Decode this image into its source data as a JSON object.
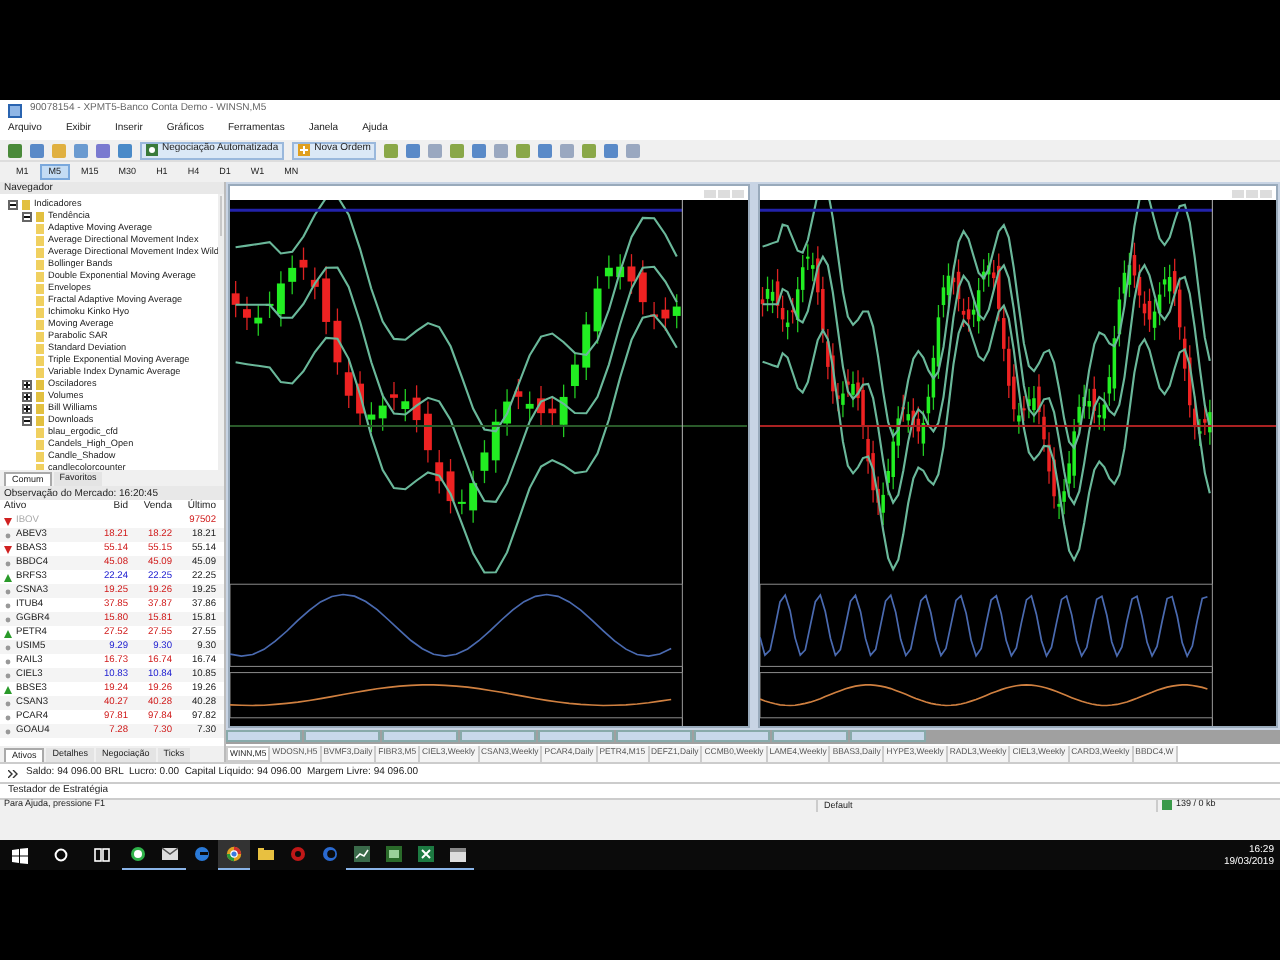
{
  "window": {
    "title": "90078154 - XPMT5-Banco Conta Demo - WINSN,M5"
  },
  "menu": [
    "Arquivo",
    "Exibir",
    "Inserir",
    "Gráficos",
    "Ferramentas",
    "Janela",
    "Ajuda"
  ],
  "toolbar": {
    "buttons": [
      {
        "kind": "auto",
        "label": "Negociação Automatizada"
      },
      {
        "kind": "order",
        "label": "Nova Ordem"
      }
    ]
  },
  "timeframes": [
    {
      "label": "M1",
      "selected": false
    },
    {
      "label": "M5",
      "selected": true
    },
    {
      "label": "M15",
      "selected": false
    },
    {
      "label": "M30",
      "selected": false
    },
    {
      "label": "H1",
      "selected": false
    },
    {
      "label": "H4",
      "selected": false
    },
    {
      "label": "D1",
      "selected": false
    },
    {
      "label": "W1",
      "selected": false
    },
    {
      "label": "MN",
      "selected": false
    }
  ],
  "navigator": {
    "title": "Navegador",
    "tree": [
      {
        "label": "Indicadores",
        "expanded": true,
        "children": [
          {
            "label": "Tendência",
            "expanded": true,
            "children": [
              {
                "label": "Adaptive Moving Average"
              },
              {
                "label": "Average Directional Movement Index"
              },
              {
                "label": "Average Directional Movement Index Wild"
              },
              {
                "label": "Bollinger Bands"
              },
              {
                "label": "Double Exponential Moving Average"
              },
              {
                "label": "Envelopes"
              },
              {
                "label": "Fractal Adaptive Moving Average"
              },
              {
                "label": "Ichimoku Kinko Hyo"
              },
              {
                "label": "Moving Average"
              },
              {
                "label": "Parabolic SAR"
              },
              {
                "label": "Standard Deviation"
              },
              {
                "label": "Triple Exponential Moving Average"
              },
              {
                "label": "Variable Index Dynamic Average"
              }
            ]
          },
          {
            "label": "Osciladores",
            "expanded": false
          },
          {
            "label": "Volumes",
            "expanded": false
          },
          {
            "label": "Bill Williams",
            "expanded": false
          },
          {
            "label": "Downloads",
            "expanded": true,
            "children": [
              {
                "label": "blau_ergodic_cfd"
              },
              {
                "label": "Candels_High_Open"
              },
              {
                "label": "Candle_Shadow"
              },
              {
                "label": "candlecolorcounter"
              }
            ]
          }
        ]
      }
    ],
    "tabs": [
      {
        "label": "Comum",
        "selected": true
      },
      {
        "label": "Favoritos",
        "selected": false
      }
    ]
  },
  "market_watch": {
    "title": "Observação do Mercado: 16:20:45",
    "columns": [
      "Ativo",
      "Bid",
      "Venda",
      "Último"
    ],
    "rows": [
      {
        "kind": "down",
        "symbol": "IBOV",
        "disabled": true,
        "last": "97502"
      },
      {
        "kind": "flat",
        "symbol": "ABEV3",
        "disabled": false,
        "rising": false,
        "bid": "18.21",
        "ask": "18.22",
        "last": "18.21"
      },
      {
        "kind": "down",
        "symbol": "BBAS3",
        "disabled": false,
        "rising": false,
        "bid": "55.14",
        "ask": "55.15",
        "last": "55.14"
      },
      {
        "kind": "flat",
        "symbol": "BBDC4",
        "disabled": false,
        "rising": false,
        "bid": "45.08",
        "ask": "45.09",
        "last": "45.09"
      },
      {
        "kind": "up",
        "symbol": "BRFS3",
        "disabled": false,
        "rising": true,
        "bid": "22.24",
        "ask": "22.25",
        "last": "22.25"
      },
      {
        "kind": "flat",
        "symbol": "CSNA3",
        "disabled": false,
        "rising": false,
        "bid": "19.25",
        "ask": "19.26",
        "last": "19.25"
      },
      {
        "kind": "flat",
        "symbol": "ITUB4",
        "disabled": false,
        "rising": false,
        "bid": "37.85",
        "ask": "37.87",
        "last": "37.86"
      },
      {
        "kind": "flat",
        "symbol": "GGBR4",
        "disabled": false,
        "rising": false,
        "bid": "15.80",
        "ask": "15.81",
        "last": "15.81"
      },
      {
        "kind": "up",
        "symbol": "PETR4",
        "disabled": false,
        "rising": false,
        "bid": "27.52",
        "ask": "27.55",
        "last": "27.55"
      },
      {
        "kind": "flat",
        "symbol": "USIM5",
        "disabled": false,
        "rising": true,
        "bid": "9.29",
        "ask": "9.30",
        "last": "9.30"
      },
      {
        "kind": "flat",
        "symbol": "RAIL3",
        "disabled": false,
        "rising": false,
        "bid": "16.73",
        "ask": "16.74",
        "last": "16.74"
      },
      {
        "kind": "flat",
        "symbol": "CIEL3",
        "disabled": false,
        "rising": true,
        "bid": "10.83",
        "ask": "10.84",
        "last": "10.85"
      },
      {
        "kind": "up",
        "symbol": "BBSE3",
        "disabled": false,
        "rising": false,
        "bid": "19.24",
        "ask": "19.26",
        "last": "19.26"
      },
      {
        "kind": "flat",
        "symbol": "CSAN3",
        "disabled": false,
        "rising": false,
        "bid": "40.27",
        "ask": "40.28",
        "last": "40.28"
      },
      {
        "kind": "flat",
        "symbol": "PCAR4",
        "disabled": false,
        "rising": false,
        "bid": "97.81",
        "ask": "97.84",
        "last": "97.82"
      },
      {
        "kind": "flat",
        "symbol": "GOAU4",
        "disabled": false,
        "rising": false,
        "bid": "7.28",
        "ask": "7.30",
        "last": "7.30"
      }
    ],
    "tabs": [
      {
        "label": "Ativos",
        "selected": true
      },
      {
        "label": "Detalhes",
        "selected": false
      },
      {
        "label": "Negociação",
        "selected": false
      },
      {
        "label": "Ticks",
        "selected": false
      }
    ]
  },
  "chart_tabs": [
    {
      "label": "WINN,M5",
      "selected": true
    },
    {
      "label": "WDOSN,H5",
      "selected": false
    },
    {
      "label": "BVMF3,Daily",
      "selected": false
    },
    {
      "label": "FIBR3,M5",
      "selected": false
    },
    {
      "label": "CIEL3,Weekly",
      "selected": false
    },
    {
      "label": "CSAN3,Weekly",
      "selected": false
    },
    {
      "label": "PCAR4,Daily",
      "selected": false
    },
    {
      "label": "PETR4,M15",
      "selected": false
    },
    {
      "label": "DEFZ1,Daily",
      "selected": false
    },
    {
      "label": "CCMB0,Weekly",
      "selected": false
    },
    {
      "label": "LAME4,Weekly",
      "selected": false
    },
    {
      "label": "BBAS3,Daily",
      "selected": false
    },
    {
      "label": "HYPE3,Weekly",
      "selected": false
    },
    {
      "label": "RADL3,Weekly",
      "selected": false
    },
    {
      "label": "CIEL3,Weekly",
      "selected": false
    },
    {
      "label": "CARD3,Weekly",
      "selected": false
    },
    {
      "label": "BBDC4,W",
      "selected": false
    }
  ],
  "account_line": "Saldo: 94 096.00 BRL  Lucro: 0.00  Capital Líquido: 94 096.00  Margem Livre: 94 096.00",
  "tester_label": "Testador de Estratégia",
  "status_bar": {
    "help": "Para Ajuda, pressione F1",
    "profile": "Default",
    "traffic": "139 / 0 kb"
  },
  "taskbar": {
    "apps": [
      {
        "kind": "whatsapp",
        "running": true,
        "selected": false
      },
      {
        "kind": "mail",
        "running": true,
        "selected": false
      },
      {
        "kind": "edge",
        "running": false,
        "selected": false
      },
      {
        "kind": "chrome",
        "running": true,
        "selected": true
      },
      {
        "kind": "folder",
        "running": false,
        "selected": false
      },
      {
        "kind": "red",
        "running": false,
        "selected": false
      },
      {
        "kind": "ccleaner",
        "running": false,
        "selected": false
      },
      {
        "kind": "chart",
        "running": true,
        "selected": false
      },
      {
        "kind": "project",
        "running": true,
        "selected": false
      },
      {
        "kind": "excel",
        "running": true,
        "selected": false
      },
      {
        "kind": "calendar",
        "running": true,
        "selected": false
      }
    ],
    "time": "16:29",
    "date": "19/03/2019"
  }
}
